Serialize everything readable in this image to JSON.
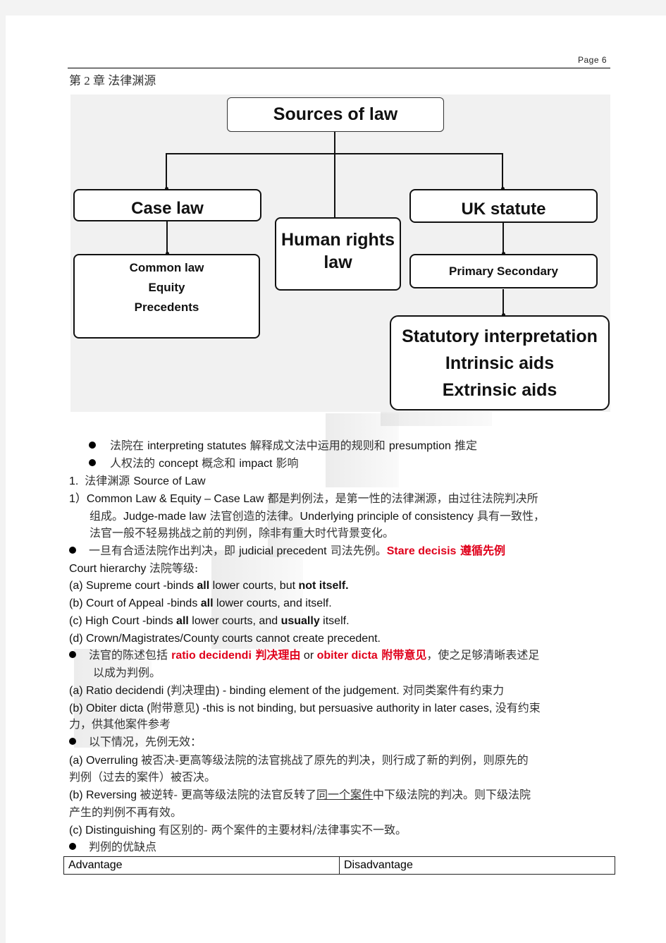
{
  "header": {
    "page_label": "Page  6",
    "chapter_title": "第 2 章  法律渊源"
  },
  "diagram": {
    "root": "Sources of law",
    "case_law": {
      "title": "Case law",
      "children": [
        "Common law",
        "Equity",
        "Precedents"
      ]
    },
    "human_rights": {
      "line1": "Human rights",
      "line2": "law"
    },
    "uk_statute": {
      "title": "UK statute",
      "child": "Primary Secondary",
      "grandchild": [
        "Statutory interpretation",
        "Intrinsic aids",
        "Extrinsic aids"
      ]
    }
  },
  "body": {
    "bullet1": {
      "zh1": "法院在 ",
      "en1": "interpreting statutes",
      "zh2": " 解释成文法中运用的规则和 ",
      "en2": "presumption",
      "zh3": " 推定"
    },
    "bullet2": {
      "zh1": "人权法的 ",
      "en1": "concept",
      "zh2": " 概念和 ",
      "en2": "impact",
      "zh3": " 影响"
    },
    "section1": {
      "num": "1.",
      "zh": "法律渊源 ",
      "en": "Source of Law"
    },
    "item1": {
      "num": "1）",
      "line1_en": "Common Law & Equity – Case Law",
      "line1_zh": " 都是判例法，是第一性的法律渊源，由过往法院判决所",
      "line2_zh1": "组成。",
      "line2_en1": "Judge-made law",
      "line2_zh2": " 法官创造的法律。",
      "line2_en2": "Underlying principle of consistency",
      "line2_zh3": " 具有一致性，",
      "line3_zh": "法官一般不轻易挑战之前的判例，除非有重大时代背景变化。"
    },
    "bullet3": {
      "zh1": "一旦有合适法院作出判决，即 ",
      "en1": "judicial precedent",
      "zh2": " 司法先例。",
      "red_en": "Stare decisis",
      "red_zh": " 遵循先例"
    },
    "court_hierarchy": {
      "en": "Court hierarchy ",
      "zh": "法院等级:"
    },
    "courts": [
      {
        "pre": "(a) Supreme court -binds ",
        "bold1": "all",
        "mid": " lower courts, but ",
        "bold2": "not itself.",
        "post": ""
      },
      {
        "pre": "(b) Court of Appeal -binds ",
        "bold1": "all",
        "mid": " lower courts, and itself.",
        "bold2": "",
        "post": ""
      },
      {
        "pre": "(c) High Court -binds ",
        "bold1": "all",
        "mid": " lower courts, and ",
        "bold2": "usually",
        "post": " itself."
      },
      {
        "pre": "(d) Crown/Magistrates/County courts cannot create precedent.",
        "bold1": "",
        "mid": "",
        "bold2": "",
        "post": ""
      }
    ],
    "bullet4": {
      "zh1": "法官的陈述包括 ",
      "red_en1": "ratio decidendi",
      "red_zh1": "  判决理由",
      "or": " or ",
      "red_en2": "obiter dicta",
      "red_zh2": " 附带意见",
      "zh2": "，使之足够清晰表述足",
      "line2": "以成为判例。"
    },
    "ratio": {
      "en1": "(a) Ratio decidendi (",
      "zh1": "判决理由",
      "en2": ") - binding element of the judgement.  ",
      "zh2": "对同类案件有约束力"
    },
    "obiter": {
      "en1": "(b) Obiter dicta (",
      "zh1": "附带意见",
      "en2": ") -this is not binding, but persuasive authority in later cases,  ",
      "zh2": "没有约束",
      "line2": "力，供其他案件参考"
    },
    "bullet5": "以下情况，先例无效：",
    "overruling": {
      "en": "(a) Overruling ",
      "zh": "被否决-更高等级法院的法官挑战了原先的判决，则行成了新的判例，则原先的",
      "line2": "判例（过去的案件）被否决。"
    },
    "reversing": {
      "en": "(b) Reversing ",
      "zh1": "被逆转- 更高等级法院的法官反转了",
      "zh_u": "同一个案件",
      "zh2": "中下级法院的判决。则下级法院",
      "line2": "产生的判例不再有效。"
    },
    "distinguishing": {
      "en": "(c) Distinguishing ",
      "zh": "有区别的- 两个案件的主要材料/法律事实不一致。"
    },
    "bullet6": "判例的优缺点"
  },
  "table": {
    "headers": [
      "Advantage",
      "Disadvantage"
    ]
  },
  "colors": {
    "emphasis_red": "#e0001b",
    "diagram_bg": "#f1f1f1"
  }
}
